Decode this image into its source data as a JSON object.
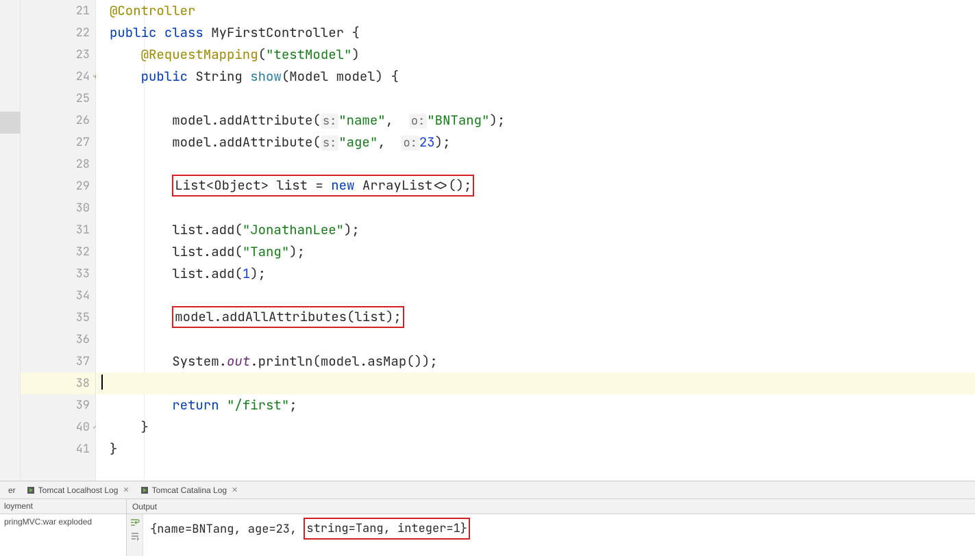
{
  "gutter": {
    "start": 21,
    "end": 41,
    "spring_line": 24,
    "icon_text": "@"
  },
  "code": {
    "l21": {
      "anno": "@Controller"
    },
    "l22": {
      "kw1": "public",
      "kw2": "class",
      "name": "MyFirstController {"
    },
    "l23": {
      "anno": "@RequestMapping",
      "open": "(",
      "str": "\"testModel\"",
      "close": ")"
    },
    "l24": {
      "kw1": "public",
      "type": "String",
      "fn": "show",
      "sig": "(Model model) {"
    },
    "l26": {
      "pre": "model.addAttribute(",
      "p1": "s:",
      "s1": "\"name\"",
      "comma": ", ",
      "p2": "o:",
      "s2": "\"BNTang\"",
      "end": ");"
    },
    "l27": {
      "pre": "model.addAttribute(",
      "p1": "s:",
      "s1": "\"age\"",
      "comma": ", ",
      "p2": "o:",
      "num": "23",
      "end": ");"
    },
    "l29": {
      "t1": "List<Object> list = ",
      "kw": "new",
      "t2": " ArrayList<>();"
    },
    "l31": {
      "pre": "list.add(",
      "str": "\"JonathanLee\"",
      "end": ");"
    },
    "l32": {
      "pre": "list.add(",
      "str": "\"Tang\"",
      "end": ");"
    },
    "l33": {
      "pre": "list.add(",
      "num": "1",
      "end": ");"
    },
    "l35": {
      "text": "model.addAllAttributes(list);"
    },
    "l37": {
      "t1": "System.",
      "field": "out",
      "t2": ".println(model.asMap());"
    },
    "l39": {
      "kw": "return",
      "sp": " ",
      "str": "\"/first\"",
      "end": ";"
    },
    "l40": {
      "text": "}"
    },
    "l41": {
      "text": "}"
    }
  },
  "tabs": {
    "t0_label": "er",
    "t1_label": "Tomcat Localhost Log",
    "t2_label": "Tomcat Catalina Log"
  },
  "panel": {
    "left_head": "loyment",
    "left_row": "pringMVC:war exploded",
    "right_head": "Output",
    "console_pre": "{name=BNTang, age=23, ",
    "console_box": "string=Tang, integer=1}"
  }
}
